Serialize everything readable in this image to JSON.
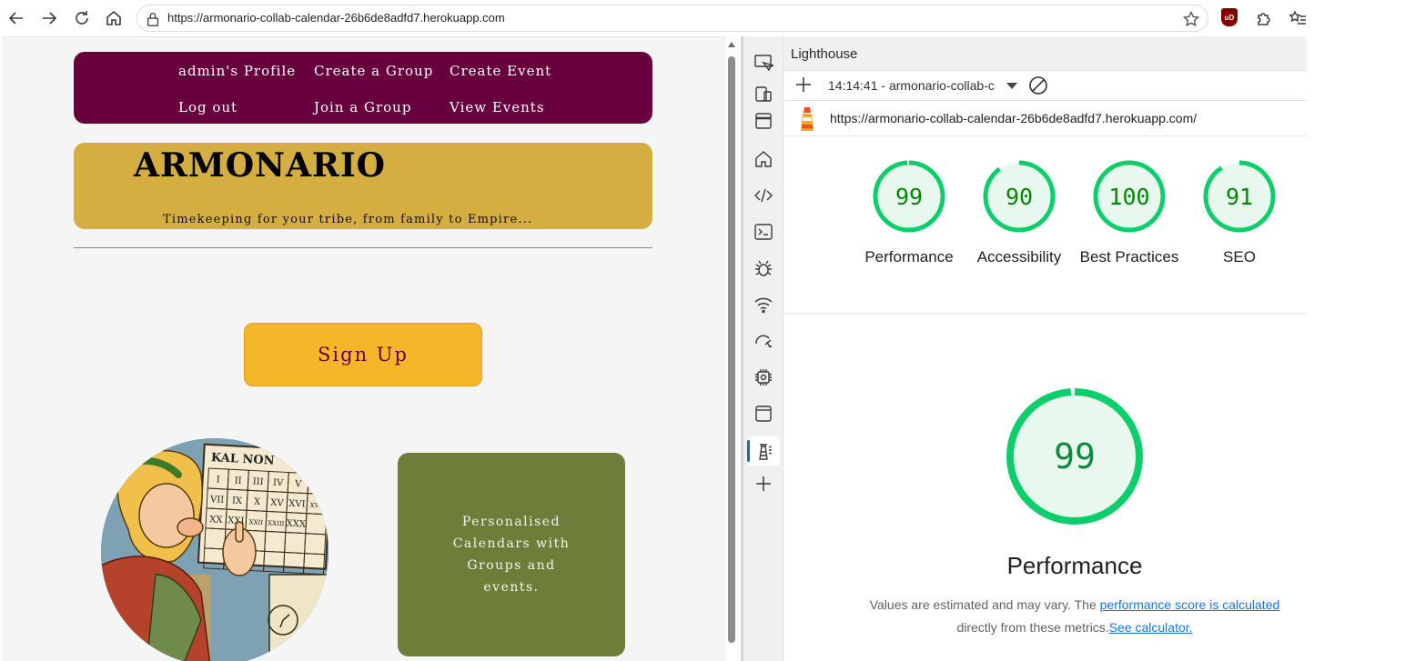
{
  "browser": {
    "url": "https://armonario-collab-calendar-26b6de8adfd7.herokuapp.com",
    "extension_badge": "uD"
  },
  "site": {
    "nav": {
      "profile": "admin's Profile",
      "create_group": "Create a Group",
      "create_event": "Create Event",
      "logout": "Log out",
      "join_group": "Join a Group",
      "view_events": "View Events"
    },
    "brand": "ARMONARIO",
    "tagline": "Timekeeping for your tribe, from family to Empire...",
    "signup_label": "Sign Up",
    "calendar_header": "KAL NON",
    "calendar_numerals": [
      "I",
      "II",
      "III",
      "IV",
      "V",
      "VI",
      "VII",
      "IX",
      "X",
      "XV",
      "XVI",
      "XVII",
      "XX",
      "XXI",
      "XXII",
      "XXIII",
      "XXX"
    ],
    "feature_text": "Personalised Calendars with Groups and events.",
    "colors": {
      "nav": "#68003d",
      "banner": "#d4ae40",
      "signup": "#f5b72a",
      "feature": "#6e7e38"
    }
  },
  "devtools": {
    "panel_title": "Lighthouse",
    "report_select": "14:14:41 - armonario-collab-c",
    "audited_url": "https://armonario-collab-calendar-26b6de8adfd7.herokuapp.com/",
    "scores": [
      {
        "value": "99",
        "label": "Performance",
        "score": 0.99
      },
      {
        "value": "90",
        "label": "Accessibility",
        "score": 0.9
      },
      {
        "value": "100",
        "label": "Best Practices",
        "score": 1.0
      },
      {
        "value": "91",
        "label": "SEO",
        "score": 0.91
      }
    ],
    "main_score": "99",
    "main_score_fraction": 0.99,
    "main_category": "Performance",
    "note_text_1": "Values are estimated and may vary. The ",
    "note_link_1": "performance score is calculated",
    "note_text_2": "directly from these metrics.",
    "note_link_2": "See calculator.",
    "colors": {
      "pass": "#0cce6b",
      "pass_text": "#008800",
      "pass_fill": "#e8f8ee"
    }
  }
}
